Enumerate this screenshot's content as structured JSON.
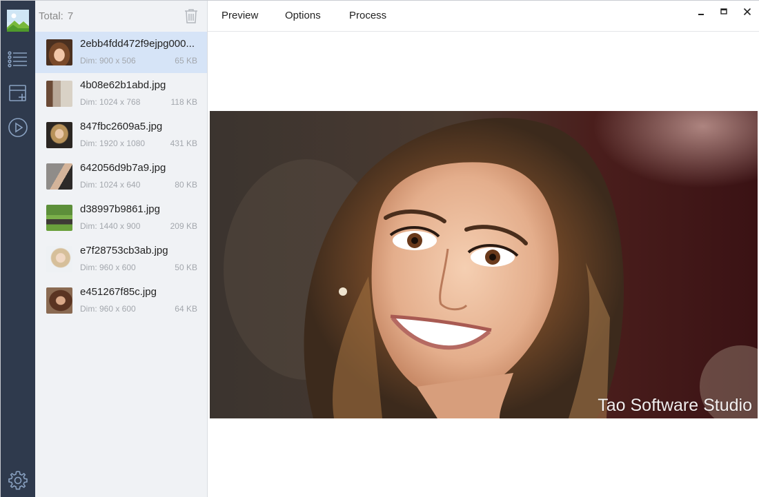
{
  "app": {
    "accent": "#d6e4f7",
    "rail_color": "#2f3a4d"
  },
  "rail": {
    "logo_icon": "image-app-logo-icon",
    "items": [
      {
        "icon": "list-icon"
      },
      {
        "icon": "add-panel-icon"
      },
      {
        "icon": "play-circle-icon"
      }
    ],
    "settings_icon": "gear-icon"
  },
  "list": {
    "total_label": "Total:",
    "total_count": "7",
    "trash_icon": "trash-icon",
    "files": [
      {
        "name": "2ebb4fdd472f9ejpg000...",
        "dim": "Dim: 900 x 506",
        "size": "65 KB"
      },
      {
        "name": "4b08e62b1abd.jpg",
        "dim": "Dim: 1024 x 768",
        "size": "118 KB"
      },
      {
        "name": "847fbc2609a5.jpg",
        "dim": "Dim: 1920 x 1080",
        "size": "431 KB"
      },
      {
        "name": "642056d9b7a9.jpg",
        "dim": "Dim: 1024 x 640",
        "size": "80 KB"
      },
      {
        "name": "d38997b9861.jpg",
        "dim": "Dim: 1440 x 900",
        "size": "209 KB"
      },
      {
        "name": "e7f28753cb3ab.jpg",
        "dim": "Dim: 960 x 600",
        "size": "50 KB"
      },
      {
        "name": "e451267f85c.jpg",
        "dim": "Dim: 960 x 600",
        "size": "64 KB"
      }
    ]
  },
  "tabs": {
    "preview": "Preview",
    "options": "Options",
    "process": "Process"
  },
  "window": {
    "minimize_icon": "minimize-icon",
    "maximize_icon": "maximize-icon",
    "close_icon": "close-icon"
  },
  "preview": {
    "watermark": "Tao Software Studio"
  }
}
